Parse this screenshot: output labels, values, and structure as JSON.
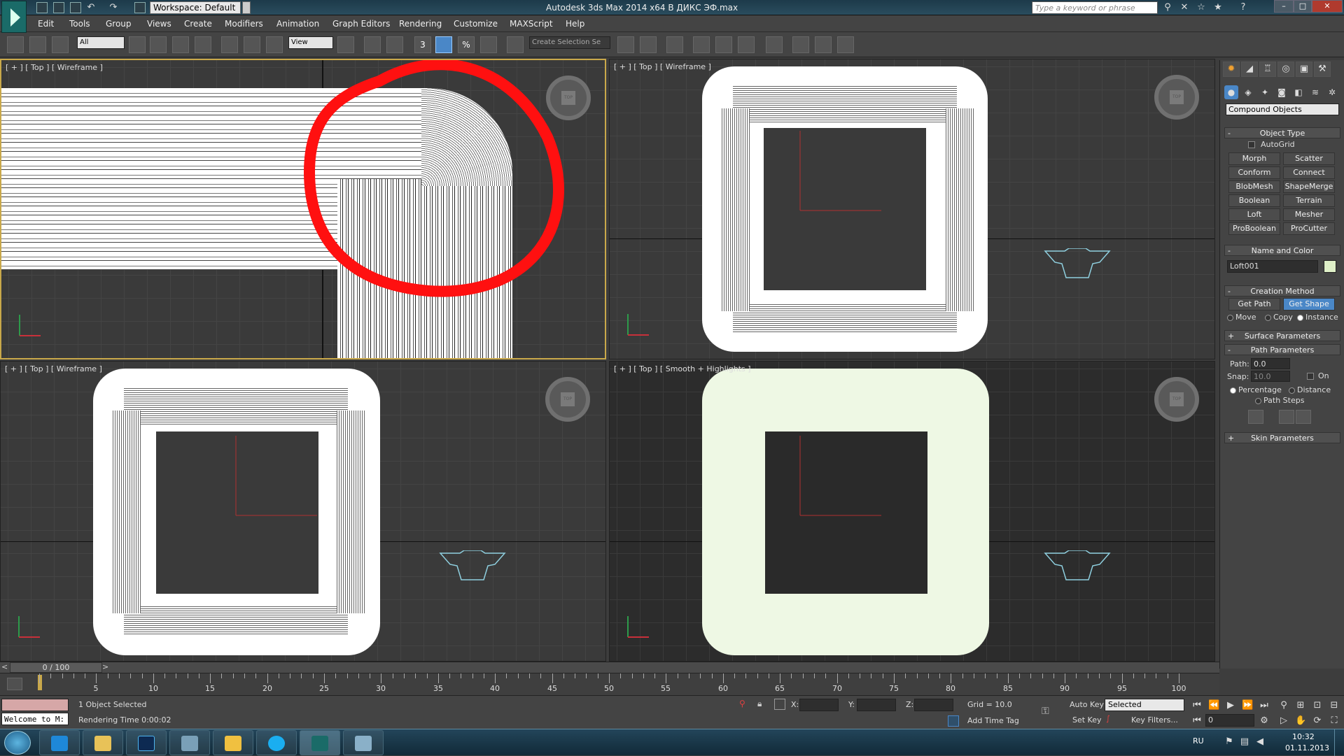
{
  "window": {
    "title": "Autodesk 3ds Max  2014 x64      В ДИКС ЭФ.max",
    "workspace": "Workspace: Default",
    "search_placeholder": "Type a keyword or phrase"
  },
  "menu": [
    "Edit",
    "Tools",
    "Group",
    "Views",
    "Create",
    "Modifiers",
    "Animation",
    "Graph Editors",
    "Rendering",
    "Customize",
    "MAXScript",
    "Help"
  ],
  "toolbar": {
    "filter_value": "All",
    "refcoord_value": "View",
    "selection_set_placeholder": "Create Selection Se",
    "snap_label": "3",
    "percent_label": "%"
  },
  "viewports": {
    "top_left": "[ + ] [ Top ] [ Wireframe ]",
    "top_right": "[ + ] [ Top ] [ Wireframe ]",
    "bottom_left": "[ + ] [ Top ] [ Wireframe ]",
    "bottom_right": "[ + ] [ Top ] [ Smooth + Highlights ]"
  },
  "command_panel": {
    "category": "Compound Objects",
    "object_type_title": "Object Type",
    "autogrid": "AutoGrid",
    "buttons": [
      "Morph",
      "Scatter",
      "Conform",
      "Connect",
      "BlobMesh",
      "ShapeMerge",
      "Boolean",
      "Terrain",
      "Loft",
      "Mesher",
      "ProBoolean",
      "ProCutter"
    ],
    "name_color_title": "Name and Color",
    "object_name": "Loft001",
    "object_color": "#dff0c8",
    "creation_method_title": "Creation Method",
    "get_path": "Get Path",
    "get_shape": "Get Shape",
    "move": "Move",
    "copy": "Copy",
    "instance": "Instance",
    "surface_params": "Surface Parameters",
    "path_params": "Path Parameters",
    "path_label": "Path:",
    "path_value": "0.0",
    "snap_label": "Snap:",
    "snap_value": "10.0",
    "on_label": "On",
    "percentage": "Percentage",
    "distance": "Distance",
    "path_steps": "Path Steps",
    "skin_params": "Skin Parameters"
  },
  "timeline": {
    "frame_counter": "0 / 100",
    "ticks": [
      "5",
      "10",
      "15",
      "20",
      "25",
      "30",
      "35",
      "40",
      "45",
      "50",
      "55",
      "60",
      "65",
      "70",
      "75",
      "80",
      "85",
      "90",
      "95",
      "100"
    ]
  },
  "status": {
    "welcome": "Welcome to M:",
    "selection": "1 Object Selected",
    "render_time": "Rendering Time  0:00:02",
    "x_label": "X:",
    "y_label": "Y:",
    "z_label": "Z:",
    "grid": "Grid = 10.0",
    "add_time_tag": "Add Time Tag",
    "auto_key": "Auto Key",
    "set_key": "Set Key",
    "key_mode": "Selected",
    "key_filters": "Key Filters...",
    "frame_value": "0"
  },
  "taskbar": {
    "lang": "RU",
    "time": "10:32",
    "date": "01.11.2013",
    "apps": [
      "start",
      "internet-explorer",
      "explorer",
      "photoshop",
      "media",
      "folder",
      "skype",
      "3dsmax",
      "window"
    ]
  },
  "colors": {
    "accent": "#4a87c7",
    "annotation": "#ff0000",
    "axis_x": "#c8303a",
    "shape_outline": "#8fd0e0"
  }
}
